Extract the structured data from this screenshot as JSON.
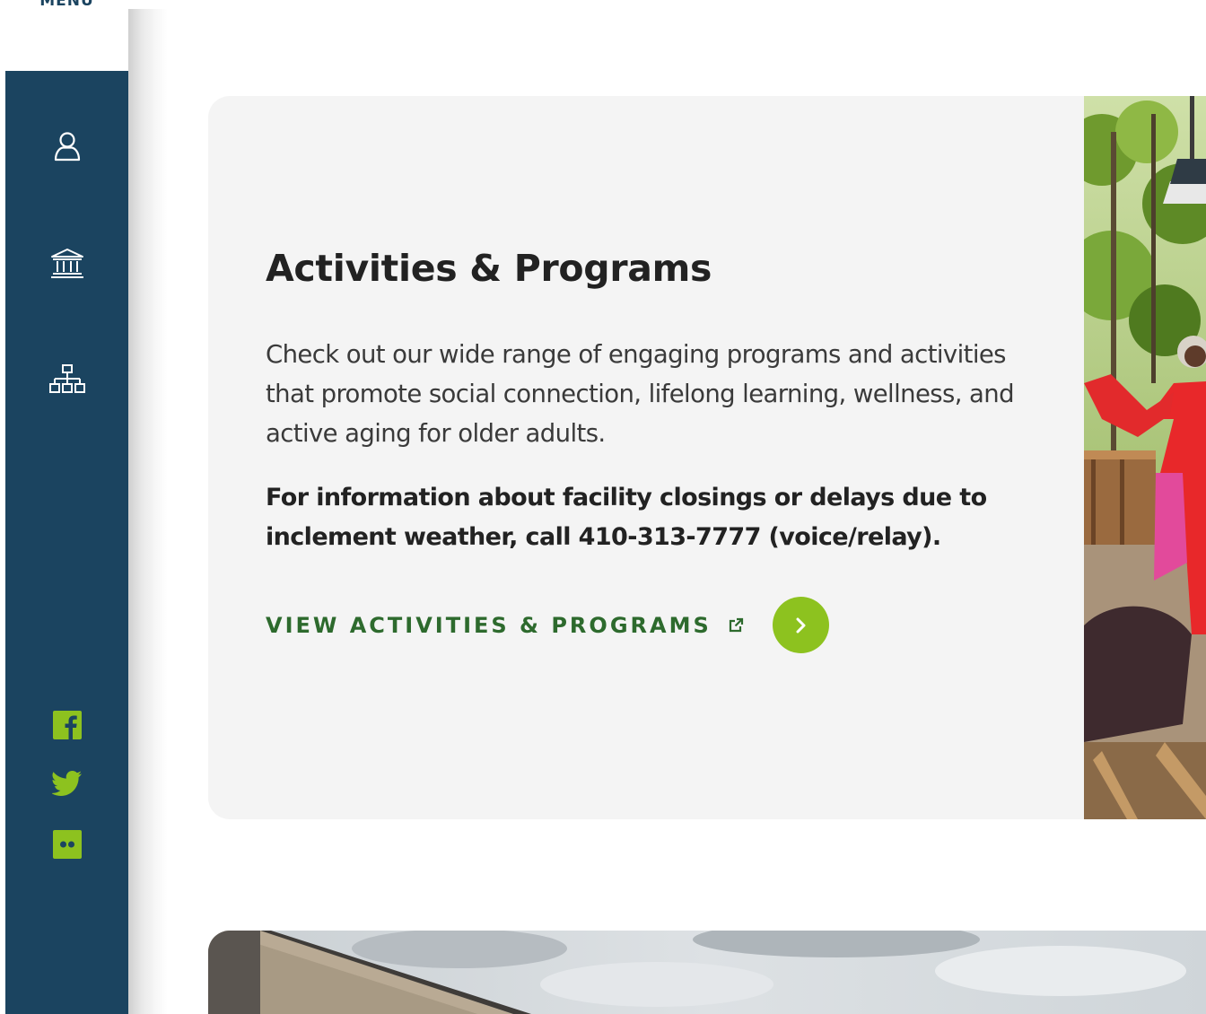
{
  "sidebar": {
    "menu_label": "MENU",
    "icons": {
      "account": "user-icon",
      "government": "building-columns-icon",
      "organization": "sitemap-icon"
    },
    "social": {
      "facebook": "facebook-icon",
      "twitter": "twitter-icon",
      "flickr": "flickr-icon"
    },
    "colors": {
      "background": "#1b4460",
      "icon": "#ffffff",
      "social": "#8dc21f"
    }
  },
  "card": {
    "title": "Activities & Programs",
    "description": "Check out our wide range of engaging programs and activities that promote social connection, lifelong learning, wellness, and active aging for older adults.",
    "notice": "For information about facility closings or delays due to inclement weather, call 410-313-7777 (voice/relay).",
    "cta_label": "VIEW ACTIVITIES & PROGRAMS",
    "cta_icon": "external-link-icon",
    "cta_arrow_icon": "chevron-right-icon",
    "colors": {
      "background": "#f4f4f4",
      "cta_text": "#2d6a2d",
      "cta_circle": "#8dc21f"
    }
  }
}
